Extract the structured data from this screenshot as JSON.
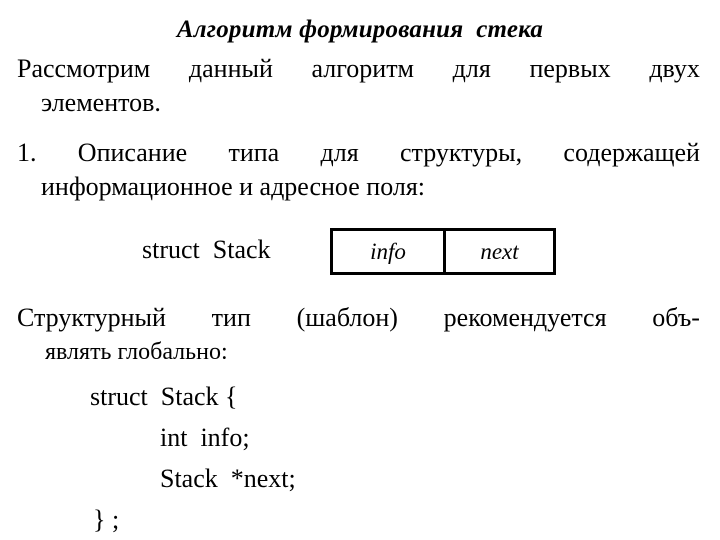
{
  "slide": {
    "background_color": "#ffffff",
    "text_color": "#000000",
    "title": "Алгоритм формирования  стека"
  },
  "intro_paragraph": {
    "line1_words": [
      "Рассмотрим",
      "данный",
      "алгоритм",
      "для",
      "первых",
      "двух"
    ],
    "line1_plain": "Рассмотрим данный алгоритм для первых двух",
    "line2": "элементов."
  },
  "item1": {
    "line1_words": [
      "1.",
      "Описание",
      "типа",
      "для",
      "структуры,",
      "содержащей"
    ],
    "line1_plain": "1. Описание типа для структуры, содержащей",
    "line2": "информационное и адресное поля:"
  },
  "struct_diagram": {
    "label": "struct  Stack",
    "fields": [
      {
        "name": "info"
      },
      {
        "name": "next"
      }
    ],
    "border_color": "#000000"
  },
  "global_paragraph": {
    "line1_words": [
      "Структурный",
      "тип",
      "(шаблон)",
      "рекомендуется",
      "объ-"
    ],
    "line1_plain": "Структурный тип (шаблон) рекомендуется объ-",
    "line2": "являть глобально:"
  },
  "code_block": {
    "lines": [
      "struct  Stack {",
      "int  info;",
      "Stack  *next;",
      "} ;"
    ]
  }
}
